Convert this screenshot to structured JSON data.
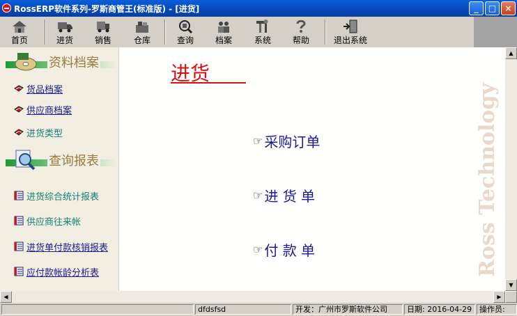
{
  "window": {
    "title": "RossERP软件系列-罗斯商管王(标准版) - [进货]",
    "minimize": "_",
    "maximize": "□",
    "close": "×"
  },
  "toolbar": {
    "buttons": [
      {
        "label": "首页",
        "icon": "home-icon"
      },
      {
        "label": "进货",
        "icon": "truck-icon"
      },
      {
        "label": "销售",
        "icon": "sales-icon"
      },
      {
        "label": "仓库",
        "icon": "warehouse-icon"
      },
      {
        "label": "查询",
        "icon": "magnifier-icon"
      },
      {
        "label": "档案",
        "icon": "archive-icon"
      },
      {
        "label": "系统",
        "icon": "tools-icon"
      },
      {
        "label": "帮助",
        "icon": "help-icon"
      },
      {
        "label": "退出系统",
        "icon": "exit-door-icon"
      }
    ]
  },
  "sidebar": {
    "archive_section": {
      "title": "资料档案",
      "items": [
        {
          "label": "货品档案"
        },
        {
          "label": "供应商档案"
        },
        {
          "label": "进货类型"
        }
      ]
    },
    "report_section": {
      "title": "查询报表",
      "items": [
        {
          "label": "进货综合统计报表"
        },
        {
          "label": "供应商往来帐"
        },
        {
          "label": "进货单付款核销报表"
        },
        {
          "label": "应付款帐龄分析表"
        }
      ]
    }
  },
  "main": {
    "title": "进货",
    "links": [
      {
        "label": "采购订单"
      },
      {
        "label": "进 货 单"
      },
      {
        "label": "付 款 单"
      }
    ],
    "watermark": "Ross Technology"
  },
  "statusbar": {
    "panel1": "",
    "panel2": "dfdsfsd",
    "developer": "开发：广州市罗斯软件公司",
    "date": "日期: 2016-04-29",
    "operator": "操作员:"
  },
  "colors": {
    "title_red": "#d81010",
    "link_blue": "#1a1a9a",
    "link_teal": "#147f74",
    "sidebar_bg": "#f2eee1"
  }
}
